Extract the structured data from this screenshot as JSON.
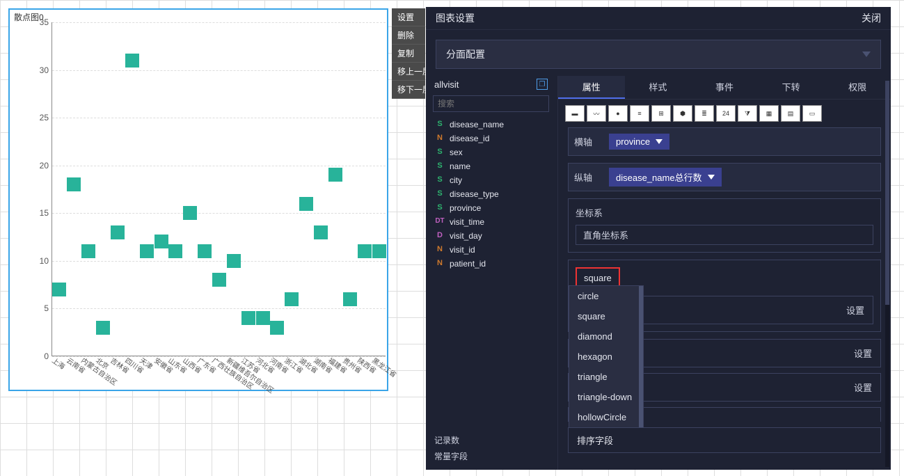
{
  "chart": {
    "title": "散点图0"
  },
  "chart_data": {
    "type": "scatter",
    "xlabel": "",
    "ylabel": "",
    "ylim": [
      0,
      35
    ],
    "yticks": [
      0,
      5,
      10,
      15,
      20,
      25,
      30,
      35
    ],
    "categories": [
      "上海",
      "云南省",
      "内蒙古自治区",
      "北京",
      "吉林省",
      "四川省",
      "天津",
      "安徽省",
      "山东省",
      "山西省",
      "广东省",
      "广西壮族自治区",
      "新疆维吾尔自治区",
      "江苏省",
      "河北省",
      "河南省",
      "浙江省",
      "湖北省",
      "湖南省",
      "福建省",
      "贵州省",
      "陕西省",
      "黑龙江省"
    ],
    "values": [
      7,
      18,
      11,
      3,
      13,
      31,
      11,
      12,
      11,
      15,
      11,
      8,
      10,
      4,
      4,
      3,
      6,
      16,
      13,
      19,
      6,
      11,
      11
    ]
  },
  "context_menu": {
    "items": [
      "设置",
      "删除",
      "复制",
      "移上一层",
      "移下一层"
    ]
  },
  "settings": {
    "title": "图表设置",
    "close": "关闭",
    "facet_label": "分面配置",
    "datasource": "allvisit",
    "search_placeholder": "搜索",
    "fields": [
      {
        "type": "S",
        "name": "disease_name"
      },
      {
        "type": "N",
        "name": "disease_id"
      },
      {
        "type": "S",
        "name": "sex"
      },
      {
        "type": "S",
        "name": "name"
      },
      {
        "type": "S",
        "name": "city"
      },
      {
        "type": "S",
        "name": "disease_type"
      },
      {
        "type": "S",
        "name": "province"
      },
      {
        "type": "DT",
        "name": "visit_time"
      },
      {
        "type": "D",
        "name": "visit_day"
      },
      {
        "type": "N",
        "name": "visit_id"
      },
      {
        "type": "N",
        "name": "patient_id"
      }
    ],
    "meta": {
      "records": "记录数",
      "constant": "常量字段"
    },
    "tabs": [
      "属性",
      "样式",
      "事件",
      "下转",
      "权限"
    ],
    "active_tab": 0,
    "axes": {
      "x_label": "横轴",
      "x_value": "province",
      "y_label": "纵轴",
      "y_value": "disease_name总行数"
    },
    "coord": {
      "label": "坐标系",
      "value": "直角坐标系"
    },
    "shape": {
      "current": "square",
      "options": [
        "circle",
        "square",
        "diamond",
        "hexagon",
        "triangle",
        "triangle-down",
        "hollowCircle"
      ]
    },
    "setting_btn": "设置",
    "sort_label": "排序字段",
    "thumb_number": "24"
  }
}
